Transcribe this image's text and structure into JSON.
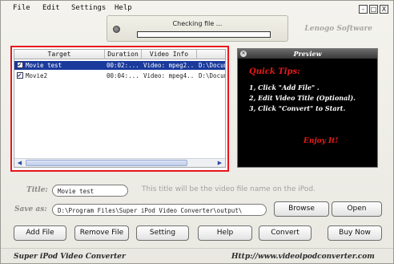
{
  "menu": [
    "File",
    "Edit",
    "Settings",
    "Help"
  ],
  "status": {
    "text": "Checking file ...",
    "progress": 0.0
  },
  "window_controls": [
    "-",
    "□",
    "X"
  ],
  "brand": "Lenogo Software",
  "file_list": {
    "columns": [
      "Target",
      "Duration",
      "Video Info",
      ""
    ],
    "rows": [
      {
        "checked": true,
        "selected": true,
        "target": "Movie test",
        "duration": "00:02:...",
        "video_info": "Video: mpeg2...",
        "path": "D:\\Docume"
      },
      {
        "checked": true,
        "selected": false,
        "target": "Movie2",
        "duration": "00:04:...",
        "video_info": "Video: mpeg4...",
        "path": "D:\\Docume"
      }
    ]
  },
  "preview": {
    "title": "Preview",
    "tips_title": "Quick Tips:",
    "tips": [
      "1, Click \"Add File\" .",
      "2, Edit Video Title (Optional).",
      "3, Click \"Convert\" to Start."
    ],
    "enjoy": "Enjoy It!"
  },
  "title_field": {
    "label": "Title:",
    "value": "Movie test",
    "hint": "This title will be the video file name on the iPod."
  },
  "save_as": {
    "label": "Save as:",
    "value": "D:\\Program Files\\Super iPod Video Converter\\output\\",
    "browse": "Browse",
    "open": "Open"
  },
  "buttons": {
    "add_file": "Add File",
    "remove_file": "Remove File",
    "setting": "Setting",
    "help": "Help",
    "convert": "Convert",
    "buy_now": "Buy Now"
  },
  "footer": {
    "app_name": "Super iPod Video Converter",
    "url": "Http://www.videoipodconverter.com"
  }
}
